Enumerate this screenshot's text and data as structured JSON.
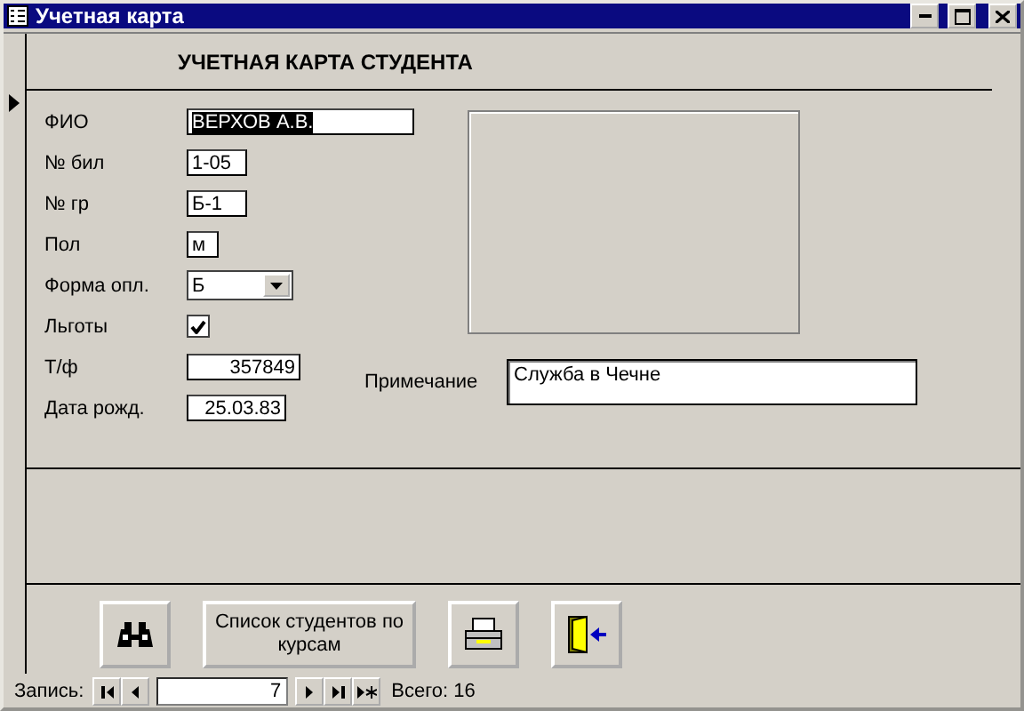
{
  "window": {
    "title": "Учетная карта"
  },
  "form": {
    "heading": "УЧЕТНАЯ КАРТА СТУДЕНТА",
    "fields": [
      {
        "label": "ФИО",
        "kind": "text",
        "value": "ВЕРХОВ А.В.",
        "selected": true
      },
      {
        "label": "№ бил",
        "kind": "text",
        "value": "1-05",
        "selected": false
      },
      {
        "label": "№ гр",
        "kind": "text",
        "value": "Б-1",
        "selected": false
      },
      {
        "label": "Пол",
        "kind": "text",
        "value": "м",
        "selected": false
      },
      {
        "label": "Форма опл.",
        "kind": "combo",
        "value": "Б",
        "selected": false
      },
      {
        "label": "Льготы",
        "kind": "checkbox",
        "checked": true
      },
      {
        "label": "Т/ф",
        "kind": "number",
        "value": "357849",
        "selected": false
      },
      {
        "label": "Дата рожд.",
        "kind": "number",
        "value": "25.03.83",
        "selected": false
      }
    ],
    "note": {
      "label": "Примечание",
      "value": "Служба в Чечне"
    }
  },
  "buttons": [
    {
      "kind": "search"
    },
    {
      "kind": "text",
      "label": "Список студентов по курсам"
    },
    {
      "kind": "print"
    },
    {
      "kind": "exit"
    }
  ],
  "navigation": {
    "label": "Запись:",
    "current": "7",
    "total_label": "Всего:",
    "total": "16"
  }
}
